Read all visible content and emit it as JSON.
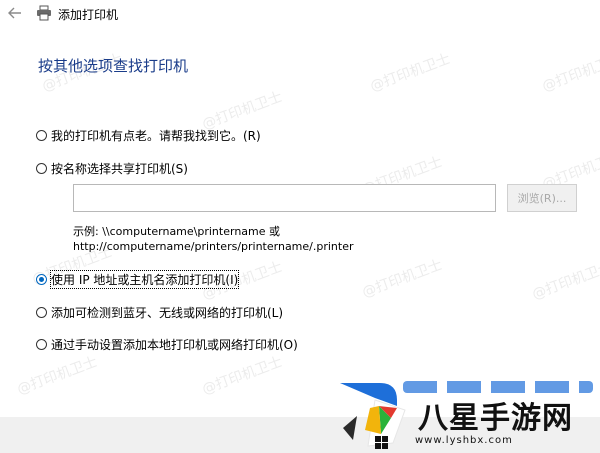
{
  "window": {
    "title": "添加打印机"
  },
  "heading": "按其他选项查找打印机",
  "options": [
    {
      "label": "我的打印机有点老。请帮我找到它。(R)",
      "checked": false
    },
    {
      "label": "按名称选择共享打印机(S)",
      "checked": false
    },
    {
      "label": "使用 IP 地址或主机名添加打印机(I)",
      "checked": true
    },
    {
      "label": "添加可检测到蓝牙、无线或网络的打印机(L)",
      "checked": false
    },
    {
      "label": "通过手动设置添加本地打印机或网络打印机(O)",
      "checked": false
    }
  ],
  "shared_printer": {
    "input_value": "",
    "browse_label": "浏览(R)...",
    "example_line1": "示例: \\\\computername\\printername 或",
    "example_line2": "http://computername/printers/printername/.printer"
  },
  "watermark": "@打印机卫士",
  "site_logo": {
    "name": "八星手游网",
    "url": "www.lyshbx.com"
  },
  "colors": {
    "accent": "#0067c0",
    "heading": "#1a3c8a"
  }
}
